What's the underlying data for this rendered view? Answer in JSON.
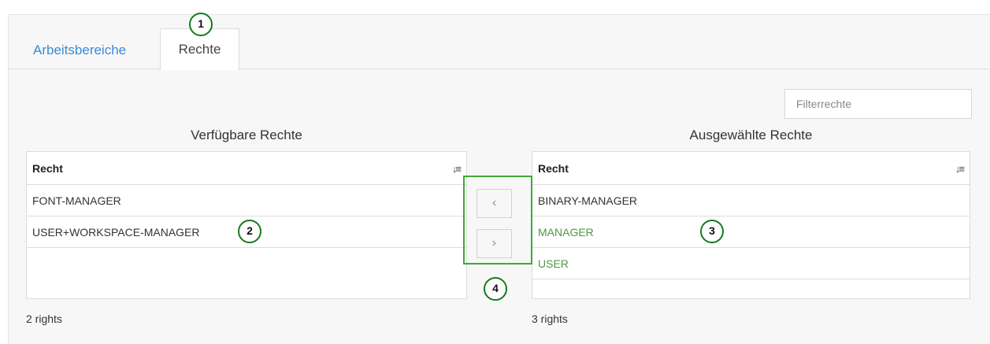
{
  "tabs": {
    "arbeitsbereiche": "Arbeitsbereiche",
    "rechte": "Rechte"
  },
  "filter": {
    "placeholder": "Filterrechte"
  },
  "available": {
    "title": "Verfügbare Rechte",
    "column_header": "Recht",
    "rows": [
      "FONT-MANAGER",
      "USER+WORKSPACE-MANAGER"
    ],
    "count": "2 rights"
  },
  "selected": {
    "title": "Ausgewählte Rechte",
    "column_header": "Recht",
    "rows": [
      "BINARY-MANAGER",
      "MANAGER",
      "USER"
    ],
    "count": "3 rights"
  },
  "buttons": {
    "move_left": "‹",
    "move_right": "›"
  },
  "sort_icon": "↓≡",
  "callouts": [
    "1",
    "2",
    "3",
    "4"
  ],
  "colors": {
    "accent_link": "#3a8ad8",
    "selected_text": "#4c9a3e",
    "callout_border": "#157a1d",
    "highlight_box": "#3fa836"
  }
}
